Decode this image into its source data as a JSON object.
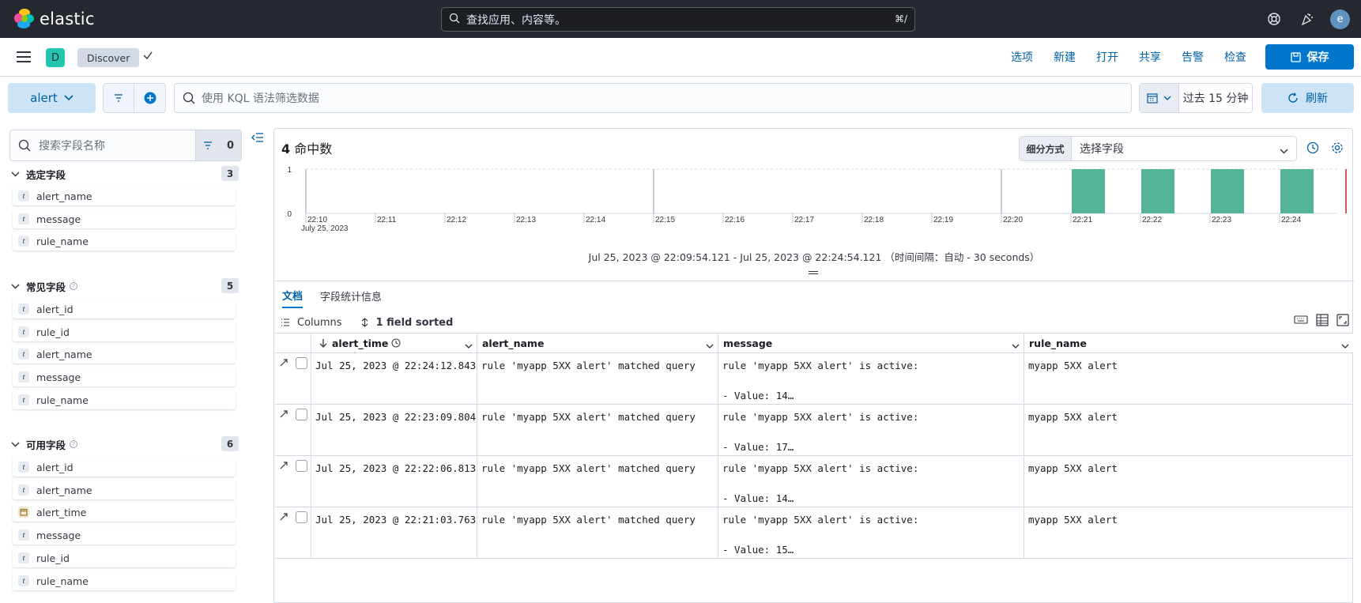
{
  "topbar": {
    "logo_text": "elastic",
    "search_placeholder": "查找应用、内容等。",
    "search_shortcut": "⌘/",
    "avatar_letter": "e",
    "icons": [
      "help-icon",
      "newsfeed-icon"
    ]
  },
  "appbar": {
    "space_letter": "D",
    "breadcrumb": "Discover",
    "links": [
      "选项",
      "新建",
      "打开",
      "共享",
      "告警",
      "检查"
    ],
    "save_label": "保存"
  },
  "querybar": {
    "data_view": "alert",
    "kql_placeholder": "使用 KQL 语法筛选数据",
    "date_label": "过去 15 分钟",
    "refresh_label": "刷新"
  },
  "sidebar": {
    "search_placeholder": "搜索字段名称",
    "filter_count": "0",
    "sections": [
      {
        "title": "选定字段",
        "count": "3",
        "help": false,
        "fields": [
          {
            "type": "t",
            "name": "alert_name"
          },
          {
            "type": "t",
            "name": "message"
          },
          {
            "type": "t",
            "name": "rule_name"
          }
        ]
      },
      {
        "title": "常见字段",
        "count": "5",
        "help": true,
        "fields": [
          {
            "type": "t",
            "name": "alert_id"
          },
          {
            "type": "t",
            "name": "rule_id"
          },
          {
            "type": "t",
            "name": "alert_name"
          },
          {
            "type": "t",
            "name": "message"
          },
          {
            "type": "t",
            "name": "rule_name"
          }
        ]
      },
      {
        "title": "可用字段",
        "count": "6",
        "help": true,
        "fields": [
          {
            "type": "t",
            "name": "alert_id"
          },
          {
            "type": "t",
            "name": "alert_name"
          },
          {
            "type": "date",
            "name": "alert_time"
          },
          {
            "type": "t",
            "name": "message"
          },
          {
            "type": "t",
            "name": "rule_id"
          },
          {
            "type": "t",
            "name": "rule_name"
          }
        ]
      }
    ]
  },
  "main": {
    "hits_count": "4",
    "hits_label": "命中数",
    "breakdown_label": "细分方式",
    "breakdown_placeholder": "选择字段",
    "time_range": "Jul 25, 2023 @ 22:09:54.121 - Jul 25, 2023 @ 22:24:54.121 （时间间隔：自动 - 30 seconds）",
    "tabs": [
      "文档",
      "字段统计信息"
    ],
    "toolbar": {
      "columns": "Columns",
      "sorted": "1 field sorted"
    },
    "columns": [
      "alert_time",
      "alert_name",
      "message",
      "rule_name"
    ],
    "rows": [
      {
        "alert_time": "Jul 25, 2023 @ 22:24:12.843",
        "alert_name": "rule 'myapp 5XX alert' matched query",
        "message": "rule 'myapp 5XX alert' is active:\n\n- Value: 14…",
        "rule_name": "myapp 5XX alert"
      },
      {
        "alert_time": "Jul 25, 2023 @ 22:23:09.804",
        "alert_name": "rule 'myapp 5XX alert' matched query",
        "message": "rule 'myapp 5XX alert' is active:\n\n- Value: 17…",
        "rule_name": "myapp 5XX alert"
      },
      {
        "alert_time": "Jul 25, 2023 @ 22:22:06.813",
        "alert_name": "rule 'myapp 5XX alert' matched query",
        "message": "rule 'myapp 5XX alert' is active:\n\n- Value: 14…",
        "rule_name": "myapp 5XX alert"
      },
      {
        "alert_time": "Jul 25, 2023 @ 22:21:03.763",
        "alert_name": "rule 'myapp 5XX alert' matched query",
        "message": "rule 'myapp 5XX alert' is active:\n\n- Value: 15…",
        "rule_name": "myapp 5XX alert"
      }
    ]
  },
  "chart_data": {
    "type": "bar",
    "categories": [
      "22:21",
      "22:22",
      "22:23",
      "22:24"
    ],
    "values": [
      1,
      1,
      1,
      1
    ],
    "x_ticks": [
      "22:10",
      "22:11",
      "22:12",
      "22:13",
      "22:14",
      "22:15",
      "22:16",
      "22:17",
      "22:18",
      "22:19",
      "22:20",
      "22:21",
      "22:22",
      "22:23",
      "22:24"
    ],
    "x_sublabel": "July 25, 2023",
    "y_ticks": [
      "0",
      "1"
    ],
    "ylim": [
      0,
      1
    ],
    "color": "#54b399",
    "now_marker_color": "#bd271e"
  },
  "colors": {
    "primary": "#0077cc",
    "header_bg": "#25282f",
    "bar": "#54b399"
  }
}
